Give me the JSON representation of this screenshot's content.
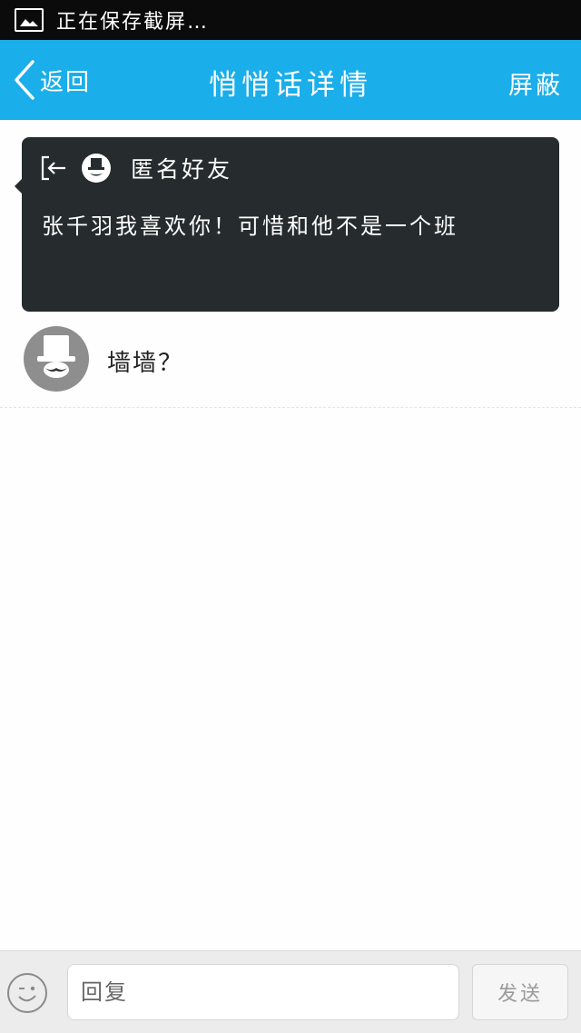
{
  "status_bar": {
    "text": "正在保存截屏…"
  },
  "header": {
    "back_label": "返回",
    "title": "悄悄话详情",
    "block_label": "屏蔽"
  },
  "message": {
    "sender_name": "匿名好友",
    "text": "张千羽我喜欢你！可惜和他不是一个班"
  },
  "reply": {
    "text": "墙墙？"
  },
  "composer": {
    "placeholder": "回复",
    "send_label": "发送"
  },
  "colors": {
    "accent": "#1aaeea",
    "card_bg": "#262c2d",
    "status_bar": "#0b0b0b"
  },
  "icons": [
    "image-icon",
    "back-chevron-icon",
    "exit-icon",
    "anonymous-avatar-icon",
    "emoji-icon"
  ]
}
